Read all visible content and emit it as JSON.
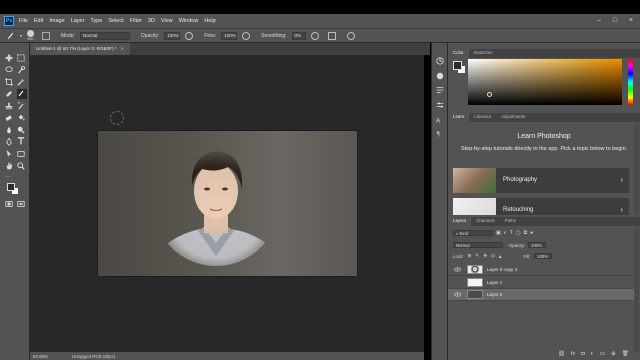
{
  "app": {
    "logo_text": "Ps",
    "menu": [
      "File",
      "Edit",
      "Image",
      "Layer",
      "Type",
      "Select",
      "Filter",
      "3D",
      "View",
      "Window",
      "Help"
    ]
  },
  "options_bar": {
    "brush_size": "900",
    "mode_label": "Mode:",
    "mode_value": "Normal",
    "opacity_label": "Opacity:",
    "opacity_value": "100%",
    "flow_label": "Flow:",
    "flow_value": "100%",
    "smoothing_label": "Smoothing:",
    "smoothing_value": "0%"
  },
  "document": {
    "tab_label": "Untitled-1 @ 60.7% (Layer 0, RGB/8*) *",
    "close_glyph": "×"
  },
  "status_bar": {
    "zoom": "60.68%",
    "profile": "Untagged RGB (8bpc)"
  },
  "color_panel": {
    "tabs": [
      "Color",
      "Swatches"
    ],
    "foreground": "#2b2b2b",
    "background": "#fafafa"
  },
  "learn_panel": {
    "tabs": [
      "Learn",
      "Libraries",
      "Adjustments"
    ],
    "title": "Learn Photoshop",
    "subtitle": "Step-by-step tutorials directly in the app. Pick a topic below to begin.",
    "cards": [
      {
        "label": "Photography",
        "chevron": "›"
      },
      {
        "label": "Retouching",
        "chevron": "›"
      }
    ]
  },
  "layers_panel": {
    "tabs": [
      "Layers",
      "Channels",
      "Paths"
    ],
    "kind_label": "Kind",
    "blend_mode": "Normal",
    "opacity_label": "Opacity:",
    "opacity_value": "100%",
    "lock_label": "Lock:",
    "fill_label": "Fill:",
    "fill_value": "100%",
    "layers": [
      {
        "name": "Layer 0 copy 3",
        "visible": true,
        "selected": false
      },
      {
        "name": "Layer 1",
        "visible": false,
        "selected": false
      },
      {
        "name": "Layer 0",
        "visible": true,
        "selected": true
      }
    ],
    "footer_icons": [
      "link-icon",
      "fx-icon",
      "mask-icon",
      "adjustment-icon",
      "group-icon",
      "new-layer-icon",
      "trash-icon"
    ]
  }
}
